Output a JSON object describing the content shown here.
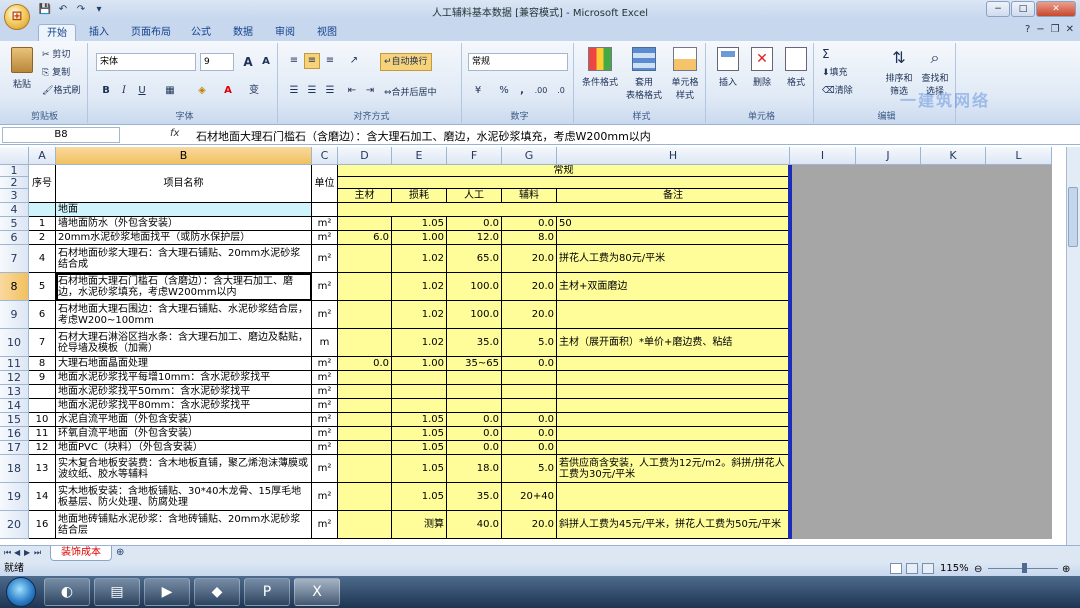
{
  "window": {
    "title": "人工辅料基本数据 [兼容模式] - Microsoft Excel",
    "office_button": "Office",
    "qat": [
      "save-icon",
      "undo-icon",
      "redo-icon",
      "dropdown-icon"
    ],
    "win_buttons": {
      "minimize": "−",
      "maximize": "□",
      "close": "✕"
    }
  },
  "ribbon_tabs": [
    "开始",
    "插入",
    "页面布局",
    "公式",
    "数据",
    "审阅",
    "视图"
  ],
  "ribbon": {
    "clipboard": {
      "paste": "粘贴",
      "cut": "剪切",
      "copy": "复制",
      "format_painter": "格式刷",
      "label": "剪贴板"
    },
    "font": {
      "name": "宋体",
      "size": "9",
      "grow": "A",
      "shrink": "A",
      "bold": "B",
      "italic": "I",
      "underline": "U",
      "label": "字体",
      "wen": "变"
    },
    "alignment": {
      "wrap_text": "自动换行",
      "merge_center": "合并后居中",
      "label": "对齐方式"
    },
    "number": {
      "format": "常规",
      "currency": "¥",
      "percent": "%",
      "comma": ",",
      "inc_dec": ".00",
      "dec_dec": ".0",
      "label": "数字"
    },
    "styles": {
      "conditional": "条件格式",
      "table_l1": "套用",
      "table_l2": "表格格式",
      "cell_l1": "单元格",
      "cell_l2": "样式",
      "label": "样式"
    },
    "cells": {
      "insert": "插入",
      "delete": "删除",
      "format": "格式",
      "label": "单元格"
    },
    "editing": {
      "autosum": "Σ",
      "fill": "填充",
      "clear": "清除",
      "sort_l1": "排序和",
      "sort_l2": "筛选",
      "find_l1": "查找和",
      "find_l2": "选择",
      "label": "编辑"
    }
  },
  "formula_bar": {
    "name_box": "B8",
    "fx": "fx",
    "formula": "石材地面大理石门槛石（含磨边）：含大理石加工、磨边，水泥砂浆填充，考虑W200mm以内"
  },
  "columns": [
    "A",
    "B",
    "C",
    "D",
    "E",
    "F",
    "G",
    "H",
    "I",
    "J",
    "K",
    "L"
  ],
  "rows": [
    "1",
    "2",
    "3",
    "4",
    "5",
    "6",
    "7",
    "8",
    "9",
    "10",
    "11",
    "12",
    "13",
    "14",
    "15",
    "16",
    "17",
    "18",
    "19",
    "20"
  ],
  "header": {
    "seq": "序号",
    "name": "项目名称",
    "unit": "单位",
    "regular": "常规",
    "main_mat": "主材",
    "loss": "损耗",
    "labor": "人工",
    "aux": "辅料",
    "remark": "备注"
  },
  "data_rows": [
    {
      "a": "",
      "b": "地面",
      "c": "",
      "d": "",
      "e": "",
      "f": "",
      "g": "",
      "h": ""
    },
    {
      "a": "1",
      "b": "墙地面防水（外包含安装）",
      "c": "m²",
      "d": "",
      "e": "1.05",
      "f": "0.0",
      "g": "0.0",
      "h": "50"
    },
    {
      "a": "2",
      "b": "20mm水泥砂浆地面找平（或防水保护层）",
      "c": "m²",
      "d": "6.0",
      "e": "1.00",
      "f": "12.0",
      "g": "8.0",
      "h": ""
    },
    {
      "a": "4",
      "b": "石材地面砂浆大理石：含大理石铺贴、20mm水泥砂浆结合成",
      "c": "m²",
      "d": "",
      "e": "1.02",
      "f": "65.0",
      "g": "20.0",
      "h": "拼花人工费为80元/平米"
    },
    {
      "a": "5",
      "b": "石材地面大理石门槛石（含磨边）：含大理石加工、磨边，水泥砂浆填充，考虑W200mm以内",
      "c": "m²",
      "d": "",
      "e": "1.02",
      "f": "100.0",
      "g": "20.0",
      "h": "主材+双面磨边"
    },
    {
      "a": "6",
      "b": "石材地面大理石围边：含大理石铺贴、水泥砂浆结合层，考虑W200~100mm",
      "c": "m²",
      "d": "",
      "e": "1.02",
      "f": "100.0",
      "g": "20.0",
      "h": ""
    },
    {
      "a": "7",
      "b": "石材大理石淋浴区挡水条：含大理石加工、磨边及黏贴，砼导墙及模板（加需）",
      "c": "m",
      "d": "",
      "e": "1.02",
      "f": "35.0",
      "g": "5.0",
      "h": "主材（展开面积）*单价+磨边费、粘结"
    },
    {
      "a": "8",
      "b": "大理石地面晶面处理",
      "c": "m²",
      "d": "0.0",
      "e": "1.00",
      "f": "35~65",
      "g": "0.0",
      "h": ""
    },
    {
      "a": "9",
      "b": "地面水泥砂浆找平每增10mm：含水泥砂浆找平",
      "c": "m²",
      "d": "",
      "e": "",
      "f": "",
      "g": "",
      "h": ""
    },
    {
      "a": "",
      "b": "地面水泥砂浆找平50mm：含水泥砂浆找平",
      "c": "m²",
      "d": "",
      "e": "",
      "f": "",
      "g": "",
      "h": ""
    },
    {
      "a": "",
      "b": "地面水泥砂浆找平80mm：含水泥砂浆找平",
      "c": "m²",
      "d": "",
      "e": "",
      "f": "",
      "g": "",
      "h": ""
    },
    {
      "a": "10",
      "b": "水泥自流平地面（外包含安装）",
      "c": "m²",
      "d": "",
      "e": "1.05",
      "f": "0.0",
      "g": "0.0",
      "h": ""
    },
    {
      "a": "11",
      "b": "环氧自流平地面（外包含安装）",
      "c": "m²",
      "d": "",
      "e": "1.05",
      "f": "0.0",
      "g": "0.0",
      "h": ""
    },
    {
      "a": "12",
      "b": "地面PVC（块料）（外包含安装）",
      "c": "m²",
      "d": "",
      "e": "1.05",
      "f": "0.0",
      "g": "0.0",
      "h": ""
    },
    {
      "a": "13",
      "b": "实木复合地板安装费：含木地板直铺，聚乙烯泡沫薄膜或波纹纸、胶水等辅料",
      "c": "m²",
      "d": "",
      "e": "1.05",
      "f": "18.0",
      "g": "5.0",
      "h": "若供应商含安装，人工费为12元/m2。斜拼/拼花人工费为30元/平米"
    },
    {
      "a": "14",
      "b": "实木地板安装：含地板铺贴、30*40木龙骨、15厚毛地板基层、防火处理、防腐处理",
      "c": "m²",
      "d": "",
      "e": "1.05",
      "f": "35.0",
      "g": "20+40",
      "h": ""
    },
    {
      "a": "16",
      "b": "地面地砖铺贴水泥砂浆：含地砖铺贴、20mm水泥砂浆结合层",
      "c": "m²",
      "d": "",
      "e": "测算",
      "f": "40.0",
      "g": "20.0",
      "h": "斜拼人工费为45元/平米，拼花人工费为50元/平米"
    }
  ],
  "sheet_tabs": {
    "active": "装饰成本",
    "nav": [
      "⏮",
      "◀",
      "▶",
      "⏭"
    ]
  },
  "status_bar": {
    "ready": "就绪",
    "zoom": "115%"
  },
  "watermark": "一建筑网络",
  "colors": {
    "yellow": "#fefd9a",
    "gray": "#a6a6a6",
    "light_blue": "#d0f4fb",
    "ribbon": "#dfe9f5"
  }
}
